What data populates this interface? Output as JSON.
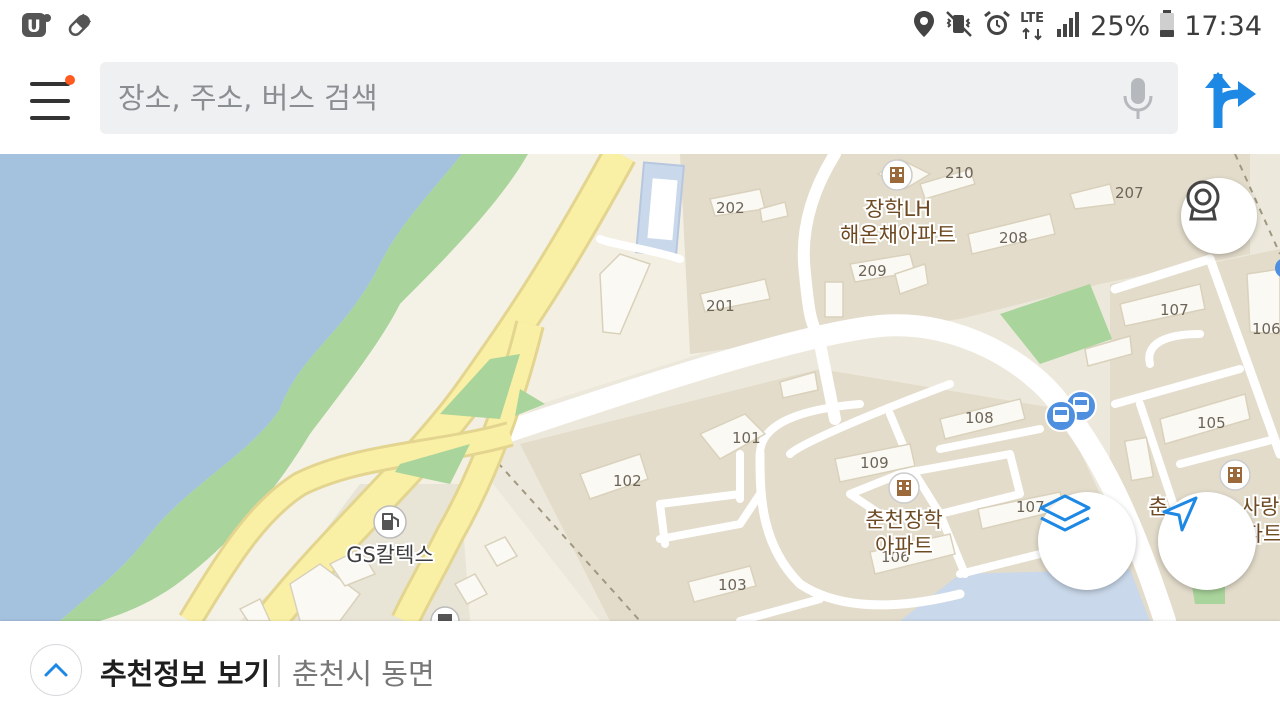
{
  "status_bar": {
    "network": "LTE",
    "battery": "25%",
    "time": "17:34"
  },
  "search": {
    "placeholder": "장소, 주소, 버스 검색"
  },
  "map": {
    "building_numbers": [
      "210",
      "207",
      "202",
      "208",
      "209",
      "201",
      "107",
      "106",
      "108",
      "105",
      "101",
      "109",
      "102",
      "107",
      "103"
    ],
    "place_labels": {
      "jangak_lh_line1": "장학LH",
      "jangak_lh_line2": "해온채아파트",
      "chuncheon_jangak_line1": "춘천장학",
      "chuncheon_jangak_line2": "아파트",
      "gas_station": "GS칼텍스",
      "partial_left": "춘",
      "partial_right_line1": "사랑",
      "partial_right_line2": "파트",
      "partial_hidden": "106"
    },
    "colors": {
      "water": "#a4c1de",
      "park": "#a9d49b",
      "road_major": "#faf0a5",
      "road_minor": "#ffffff",
      "land": "#ece8db",
      "bus_stop": "#4f8fe0",
      "poi_brown": "#8b5a2b"
    }
  },
  "bottom_panel": {
    "title": "추천정보 보기",
    "location": "춘천시 동면"
  },
  "colors": {
    "accent": "#1e88e5",
    "notification_dot": "#ff5a1f"
  }
}
